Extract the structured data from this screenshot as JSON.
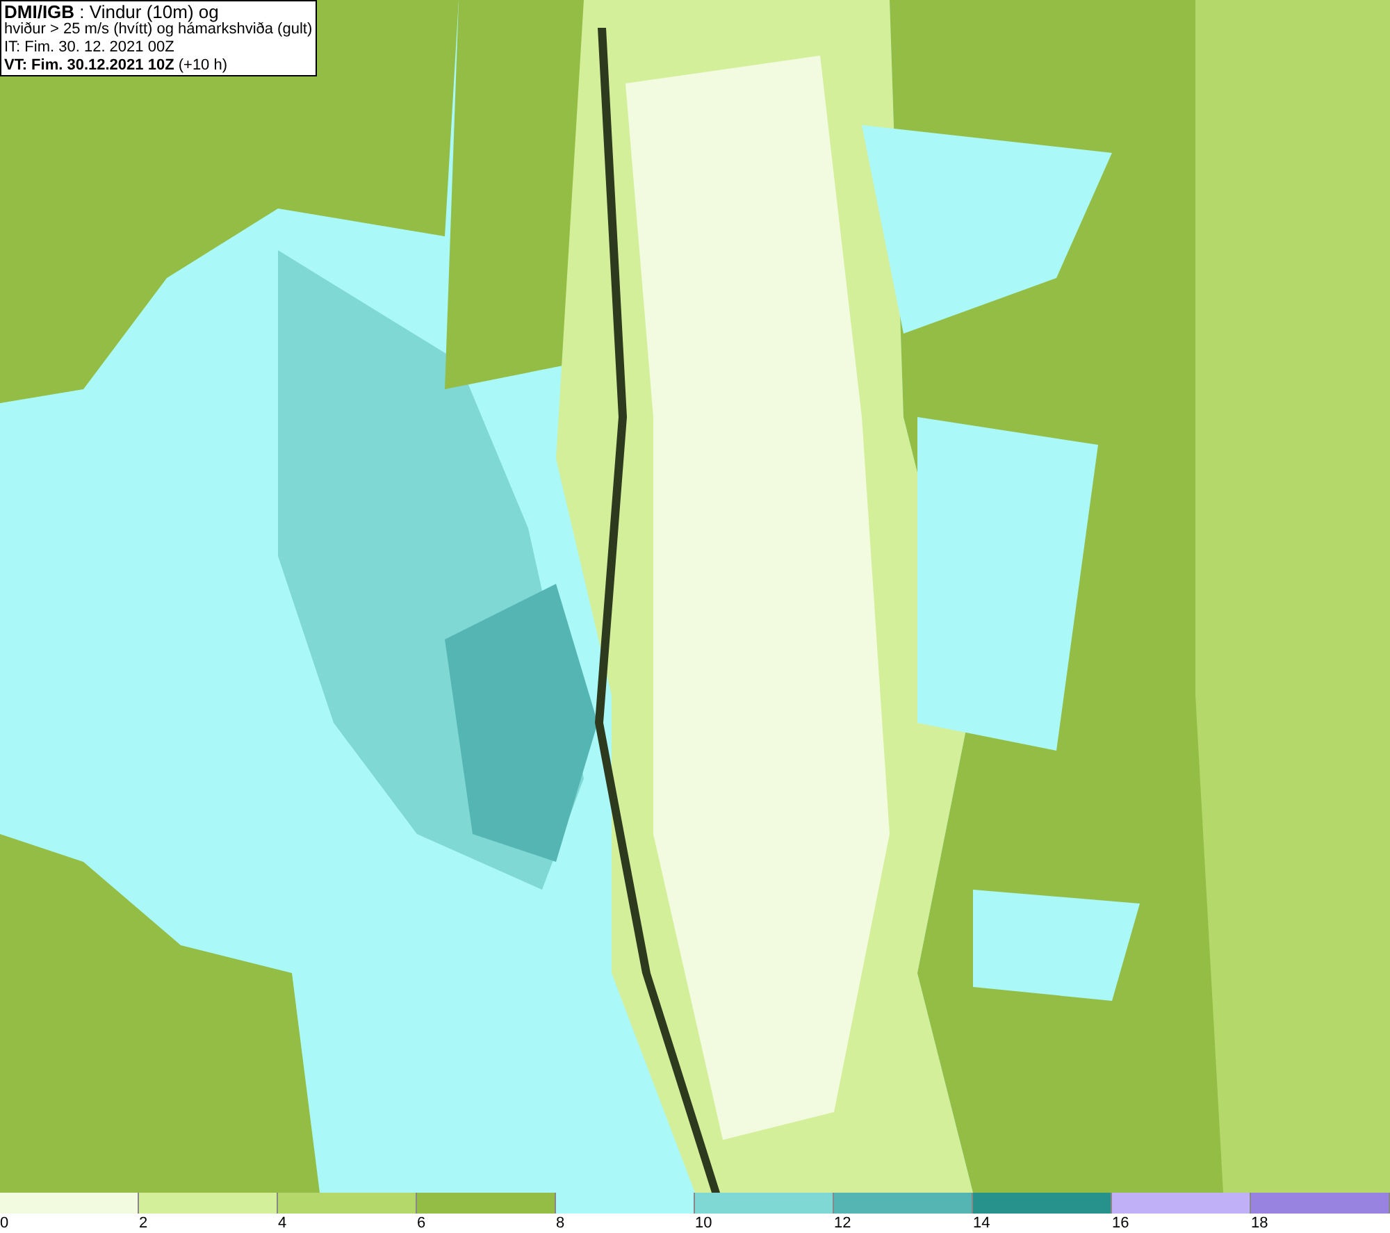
{
  "info_box": {
    "lines": [
      "**DMI/IGB** : Vindur (10m) og",
      "hviður > 25 m/s (hvítt) og hámarkshviða (gult)",
      "IT: Fim. 30. 12. 2021 00Z",
      "**VT: Fim. 30.12.2021 10Z** (+10 h)"
    ]
  },
  "color_scale": {
    "bins": [
      {
        "color": "#f2fbe0"
      },
      {
        "color": "#d4ef9a"
      },
      {
        "color": "#b5d86a"
      },
      {
        "color": "#93bd44"
      },
      {
        "color": "#aaf8f8"
      },
      {
        "color": "#7fd8d4"
      },
      {
        "color": "#55b5b3"
      },
      {
        "color": "#27928c"
      },
      {
        "color": "#c0b0f8"
      },
      {
        "color": "#9884e0"
      }
    ],
    "labels": [
      "0",
      "2",
      "4",
      "6",
      "8",
      "10",
      "12",
      "14",
      "16",
      "18"
    ]
  }
}
